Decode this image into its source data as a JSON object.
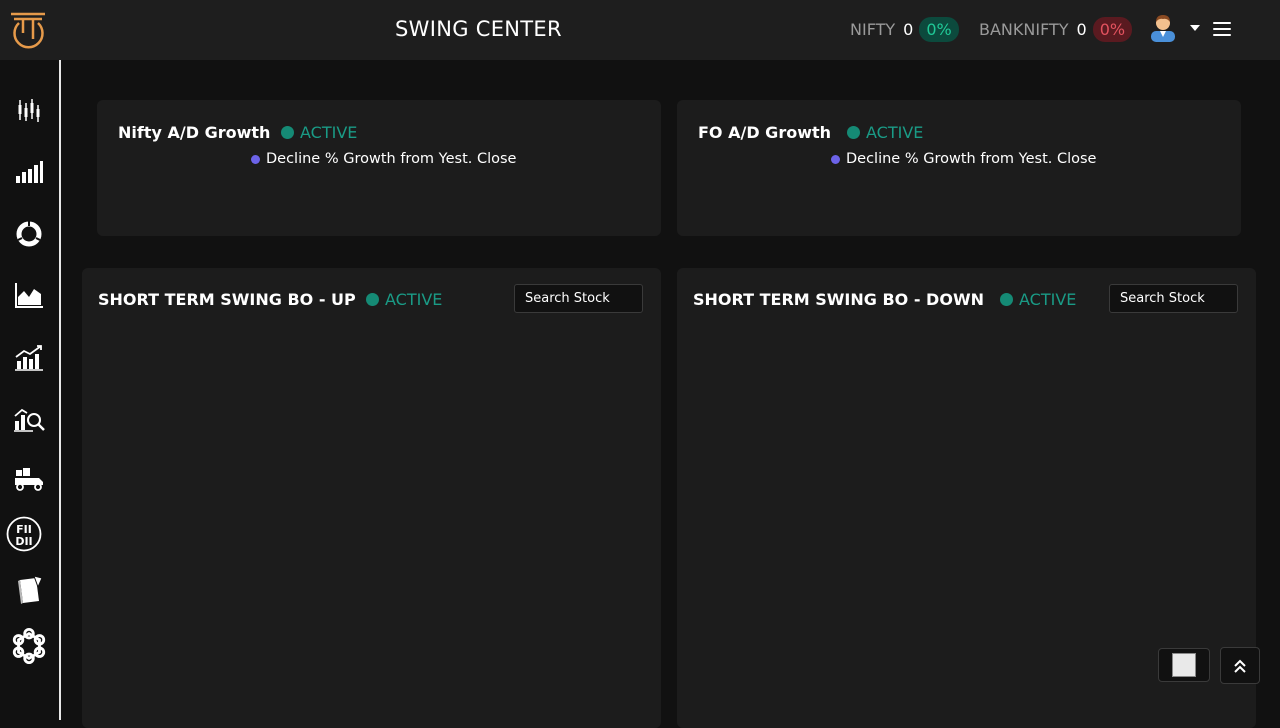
{
  "header": {
    "title": "SWING CENTER",
    "tickers": [
      {
        "name": "NIFTY",
        "value": "0",
        "change": "0%",
        "trend": "up"
      },
      {
        "name": "BANKNIFTY",
        "value": "0",
        "change": "0%",
        "trend": "down"
      }
    ]
  },
  "sidebar": {
    "items": [
      {
        "icon": "candlestick-icon"
      },
      {
        "icon": "bar-chart-icon"
      },
      {
        "icon": "donut-chart-icon"
      },
      {
        "icon": "area-chart-icon"
      },
      {
        "icon": "growth-chart-icon"
      },
      {
        "icon": "chart-search-icon"
      },
      {
        "icon": "delivery-truck-icon"
      },
      {
        "icon": "fii-dii-icon",
        "text_top": "FII",
        "text_bottom": "DII"
      },
      {
        "icon": "notebook-icon"
      },
      {
        "icon": "network-icon"
      }
    ]
  },
  "cards": {
    "nifty_ad": {
      "title": "Nifty A/D Growth",
      "status": "ACTIVE",
      "legend": "Decline % Growth from Yest. Close"
    },
    "fo_ad": {
      "title": "FO A/D Growth",
      "status": "ACTIVE",
      "legend": "Decline % Growth from Yest. Close"
    },
    "swing_up": {
      "title": "SHORT TERM SWING BO - UP",
      "status": "ACTIVE",
      "search_label": "Search Stock"
    },
    "swing_down": {
      "title": "SHORT TERM SWING BO - DOWN",
      "status": "ACTIVE",
      "search_label": "Search Stock"
    }
  },
  "colors": {
    "active": "#1a9b86",
    "legend_dot": "#6c63e8",
    "positive": "#20c997",
    "negative": "#e2525e"
  }
}
